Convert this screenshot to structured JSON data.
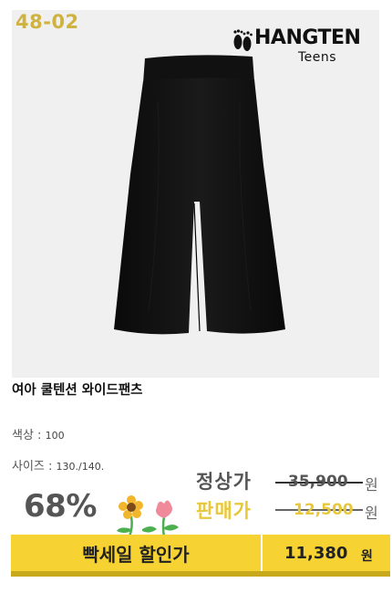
{
  "product": {
    "code": "48-02",
    "brand": {
      "main": "HANGTEN",
      "sub": "Teens"
    },
    "name": "여아 쿨텐션 와이드팬츠",
    "color_label": "색상 :",
    "color_value": "100",
    "size_label": "사이즈 :",
    "size_value": "130./140."
  },
  "pricing": {
    "discount": "68%",
    "regular_label": "정상가",
    "regular_price": "35,900",
    "sale_label": "판매가",
    "sale_price": "12,500",
    "won": "원"
  },
  "banner": {
    "label": "빡세일 할인가",
    "price": "11,380",
    "won": "원"
  },
  "colors": {
    "accent": "#f6d232",
    "code": "#cfb23f",
    "sale_price": "#e8c73a"
  },
  "icons": [
    "footprint-logo-icon",
    "flower-icon"
  ]
}
